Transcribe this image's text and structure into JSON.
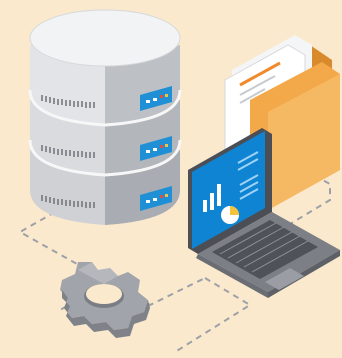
{
  "scene": {
    "description_visible_text": [],
    "colors": {
      "background": "#fbe9cd",
      "server_light": "#e9eaec",
      "server_mid": "#cfd1d5",
      "server_dark": "#a9acb2",
      "server_top": "#f2f3f5",
      "panel_blue": "#1f8fd6",
      "folder": "#f3a94a",
      "folder_dark": "#d98a2c",
      "laptop_body": "#7c7f85",
      "laptop_dark": "#4b4e55",
      "screen_blue": "#0f84d3",
      "gear": "#a1a4aa",
      "gear_light": "#c3c5c9",
      "dashed_line": "#9da1a7"
    },
    "icons": [
      "database-server-icon",
      "folder-with-documents-icon",
      "laptop-dashboard-icon",
      "gear-icon"
    ]
  }
}
